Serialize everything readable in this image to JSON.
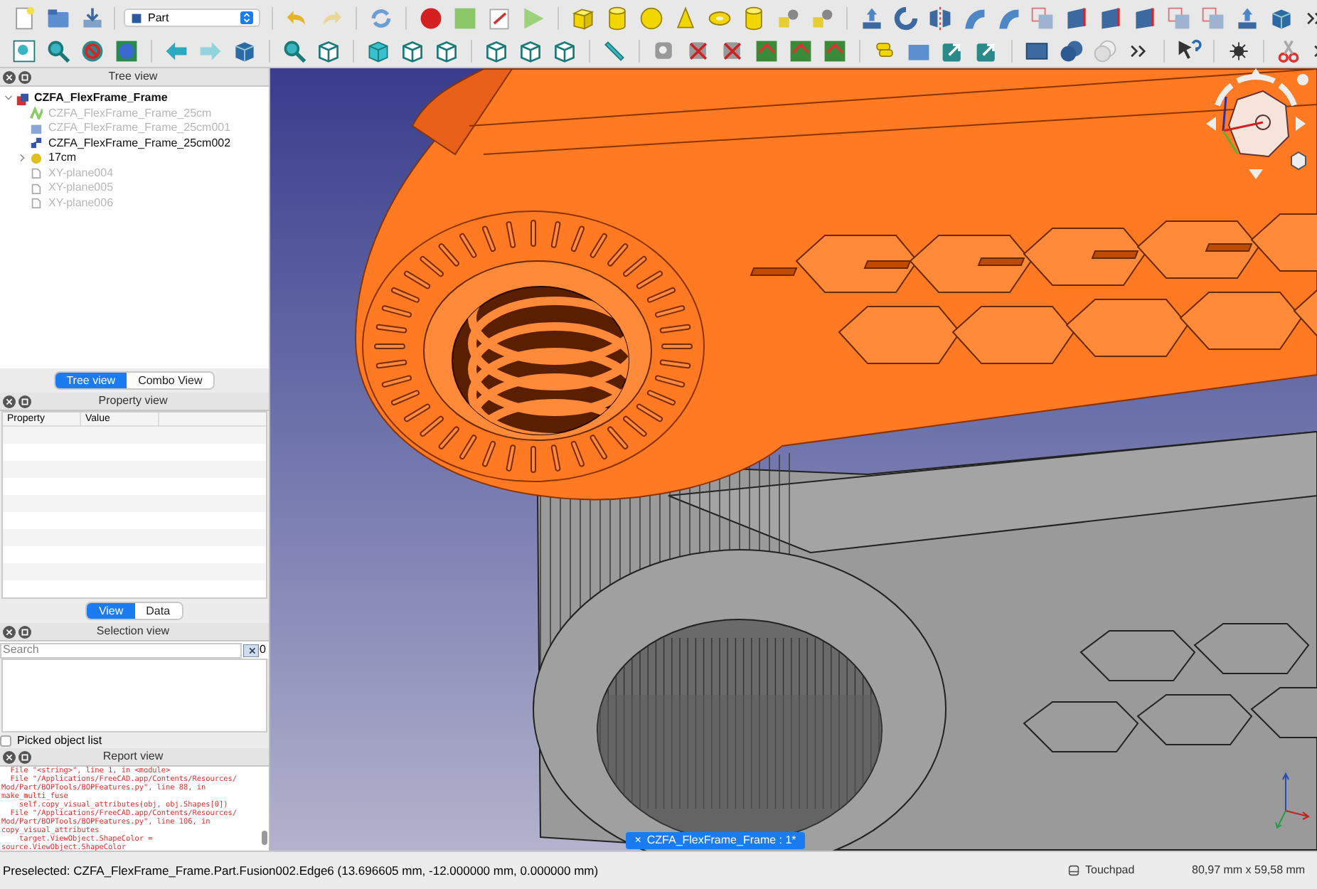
{
  "toolbar": {
    "workbench": "Part"
  },
  "tree_view": {
    "title": "Tree view",
    "items": [
      {
        "label": "CZFA_FlexFrame_Frame",
        "kind": "part",
        "visible": true,
        "expanded": true,
        "children": [
          {
            "label": "CZFA_FlexFrame_Frame_25cm",
            "kind": "sketch",
            "visible": false
          },
          {
            "label": "CZFA_FlexFrame_Frame_25cm001",
            "kind": "shape",
            "visible": false
          },
          {
            "label": "CZFA_FlexFrame_Frame_25cm002",
            "kind": "link",
            "visible": true
          },
          {
            "label": "17cm",
            "kind": "group",
            "visible": true,
            "expanded": false
          },
          {
            "label": "XY-plane004",
            "kind": "plane",
            "visible": false
          },
          {
            "label": "XY-plane005",
            "kind": "plane",
            "visible": false
          },
          {
            "label": "XY-plane006",
            "kind": "plane",
            "visible": false
          }
        ]
      }
    ]
  },
  "combo_tabs": [
    {
      "label": "Tree view",
      "selected": true
    },
    {
      "label": "Combo View",
      "selected": false
    }
  ],
  "property_view": {
    "title": "Property view",
    "columns": [
      "Property",
      "Value"
    ]
  },
  "property_tabs": [
    {
      "label": "View",
      "selected": true
    },
    {
      "label": "Data",
      "selected": false
    }
  ],
  "selection_view": {
    "title": "Selection view",
    "search": {
      "placeholder": "Search"
    },
    "count": "0",
    "picked_list": {
      "label": "Picked object list",
      "checked": false
    }
  },
  "report_view": {
    "title": "Report view",
    "lines": [
      "  File \"<string>\", line 1, in <module>",
      "  File \"/Applications/FreeCAD.app/Contents/Resources/",
      "Mod/Part/BOPTools/BOPFeatures.py\", line 88, in",
      "make_multi_fuse",
      "    self.copy_visual_attributes(obj, obj.Shapes[0])",
      "  File \"/Applications/FreeCAD.app/Contents/Resources/",
      "Mod/Part/BOPTools/BOPFeatures.py\", line 106, in",
      "copy_visual_attributes",
      "    target.ViewObject.ShapeColor =",
      "source.ViewObject.ShapeColor"
    ]
  },
  "document_tab": {
    "label": "CZFA_FlexFrame_Frame : 1*",
    "close": "×"
  },
  "status_bar": {
    "message": "Preselected: CZFA_FlexFrame_Frame.Part.Fusion002.Edge6 (13.696605 mm, -12.000000 mm, 0.000000 mm)",
    "navigation": "Touchpad",
    "dimensions": "80,97 mm x 59,58 mm"
  }
}
